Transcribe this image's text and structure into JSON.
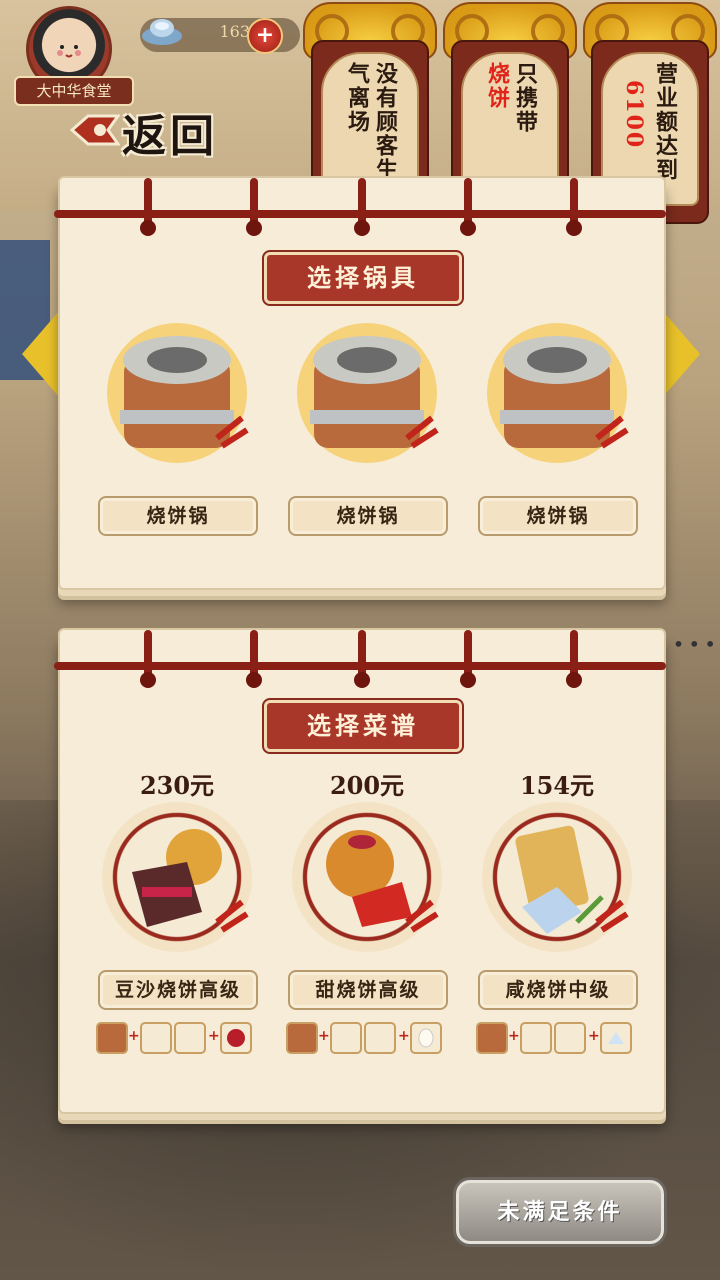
{
  "header": {
    "shop_name": "大中华食堂",
    "currency_value": "163",
    "plus_label": "+",
    "back_label": "返回"
  },
  "tasks": [
    {
      "col1": "没有顾客生",
      "col2": "气离场",
      "col1_red": false,
      "col2_red": false
    },
    {
      "col1": "只携带",
      "col2": "烧饼",
      "col1_red": false,
      "col2_red": true
    },
    {
      "col1": "营业额达到",
      "col2": "6100",
      "col1_red": false,
      "col2_red": true
    }
  ],
  "cookware": {
    "title": "选择锅具",
    "items": [
      {
        "label": "烧饼锅"
      },
      {
        "label": "烧饼锅"
      },
      {
        "label": "烧饼锅"
      }
    ]
  },
  "recipes": {
    "title": "选择菜谱",
    "items": [
      {
        "price": "230元",
        "label": "豆沙烧饼高级",
        "extra_icon": "red-bean-icon"
      },
      {
        "price": "200元",
        "label": "甜烧饼高级",
        "extra_icon": "sugar-icon"
      },
      {
        "price": "154元",
        "label": "咸烧饼中级",
        "extra_icon": "salt-icon"
      }
    ]
  },
  "confirm_button": "未满足条件",
  "colors": {
    "accent_red": "#a8372a",
    "paper": "#f6ecd8",
    "gold": "#f7cf42",
    "button_gray": "#8f8a83"
  }
}
